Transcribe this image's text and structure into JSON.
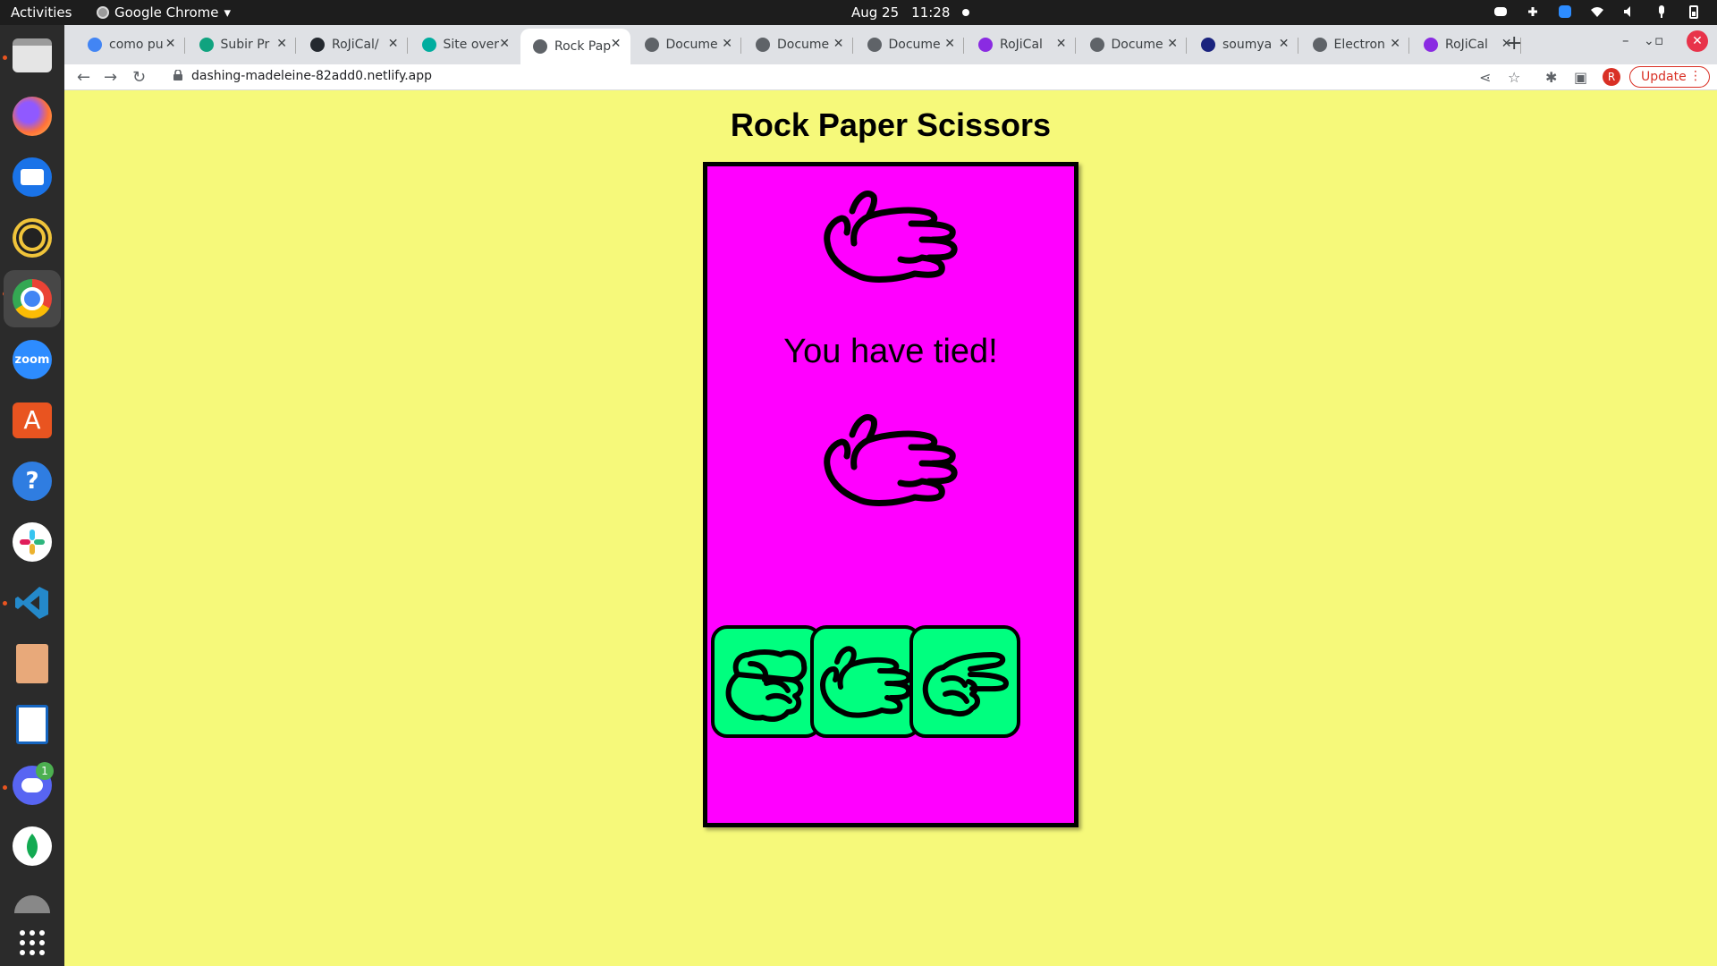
{
  "system_bar": {
    "activities": "Activities",
    "app_name": "Google Chrome",
    "date": "Aug 25",
    "time": "11:28"
  },
  "dock": {
    "items": [
      "files-icon",
      "firefox-icon",
      "thunderbird-icon",
      "rhythmbox-icon",
      "chrome-icon",
      "zoom-icon",
      "app-center-icon",
      "help-icon",
      "slack-icon",
      "vscode-icon",
      "archive-icon",
      "writer-icon",
      "discord-icon",
      "mongodb-icon",
      "updates-icon",
      "show-apps-icon"
    ],
    "zoom_label": "zoom",
    "discord_badge": "1"
  },
  "browser": {
    "tabs": [
      {
        "title": "como pu",
        "color": "#4285f4"
      },
      {
        "title": "Subir Pr",
        "color": "#10a37f"
      },
      {
        "title": "RoJiCal/",
        "color": "#24292f"
      },
      {
        "title": "Site over",
        "color": "#00ad9f"
      },
      {
        "title": "Rock Pap",
        "color": "#5f6368"
      },
      {
        "title": "Docume",
        "color": "#5f6368"
      },
      {
        "title": "Docume",
        "color": "#5f6368"
      },
      {
        "title": "Docume",
        "color": "#5f6368"
      },
      {
        "title": "RoJiCal",
        "color": "#8a2be2"
      },
      {
        "title": "Docume",
        "color": "#5f6368"
      },
      {
        "title": "soumya",
        "color": "#1a237e"
      },
      {
        "title": "Electron",
        "color": "#5f6368"
      },
      {
        "title": "RoJiCal",
        "color": "#8a2be2"
      }
    ],
    "active_tab_index": 4,
    "url": "dashing-madeleine-82add0.netlify.app",
    "profile_initial": "R",
    "update_label": "Update"
  },
  "game": {
    "title": "Rock Paper Scissors",
    "computer_choice": "paper",
    "player_choice": "paper",
    "result_text": "You have tied!",
    "choices": [
      "rock",
      "paper",
      "scissors"
    ],
    "colors": {
      "background": "#f6f97a",
      "board": "#ff00ff",
      "buttons": "#00ff7f"
    }
  }
}
